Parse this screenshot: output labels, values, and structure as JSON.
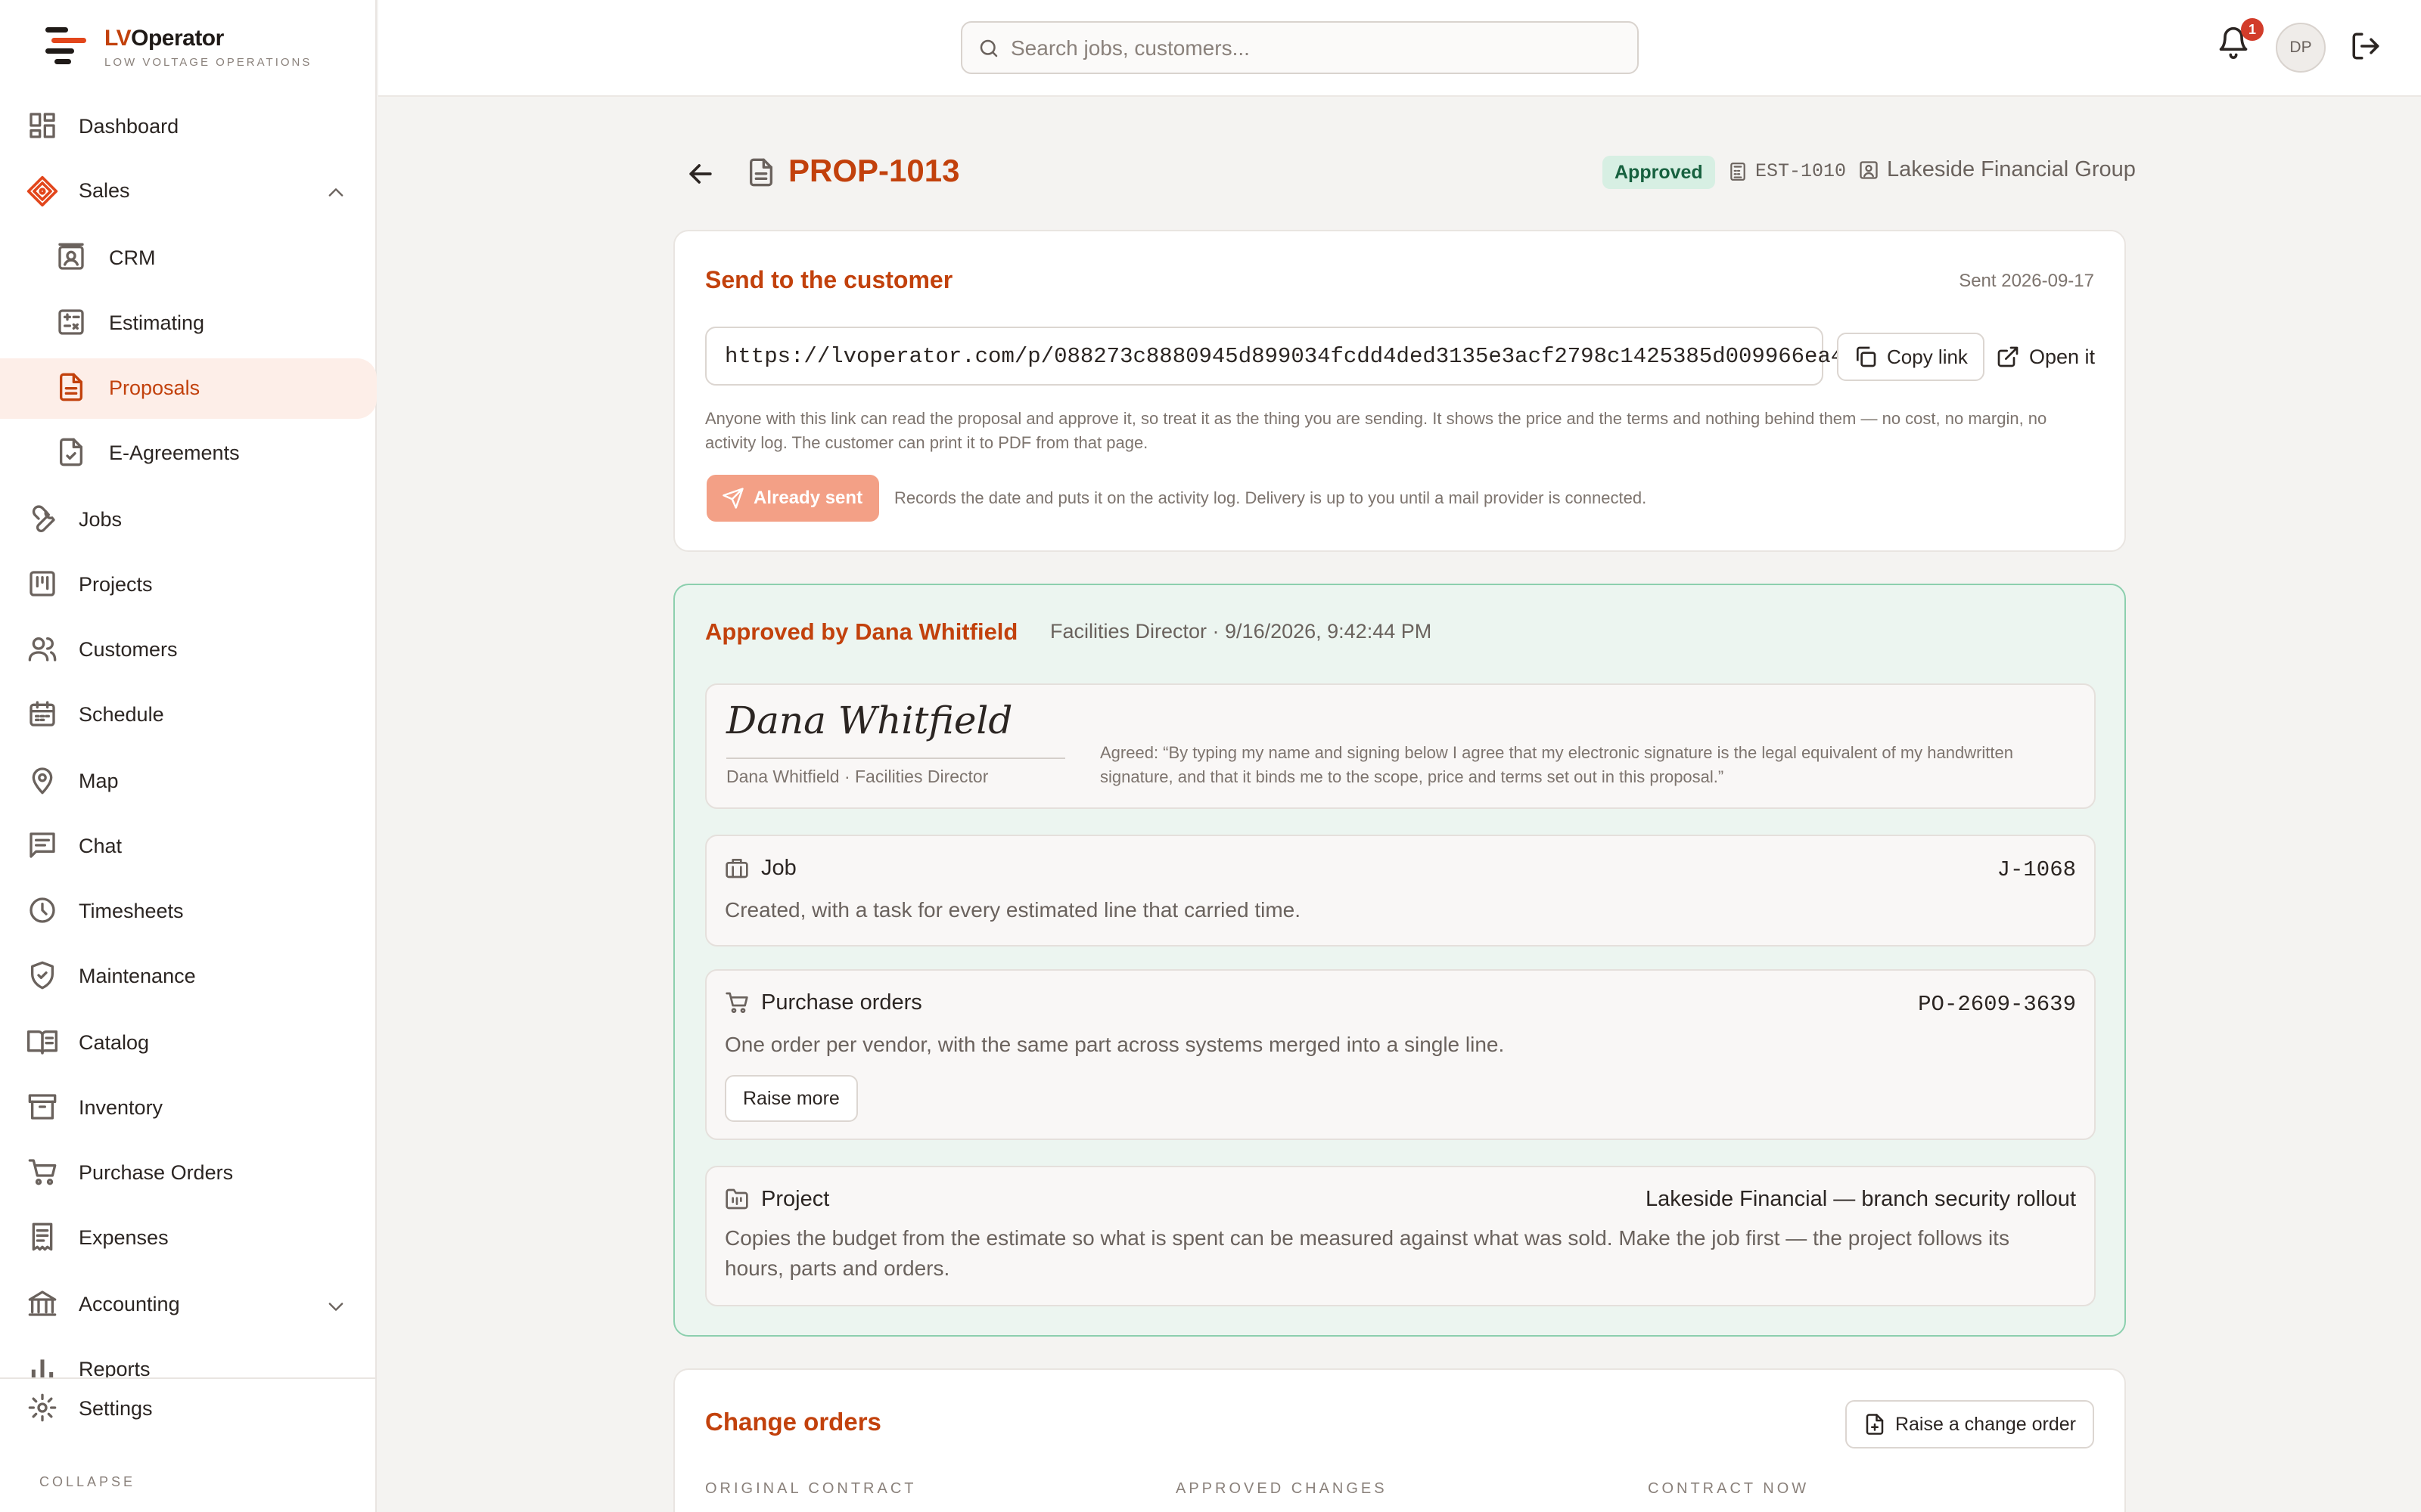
{
  "app": {
    "name_prefix": "LV",
    "name_rest": "Operator",
    "subtitle": "LOW VOLTAGE OPERATIONS"
  },
  "sidebar": {
    "items": [
      {
        "label": "Dashboard",
        "icon": "dashboard-icon"
      },
      {
        "label": "Sales",
        "icon": "tag-icon"
      },
      {
        "label": "CRM",
        "icon": "contact-card-icon"
      },
      {
        "label": "Estimating",
        "icon": "calculator-icon"
      },
      {
        "label": "Proposals",
        "icon": "document-icon"
      },
      {
        "label": "E-Agreements",
        "icon": "file-check-icon"
      },
      {
        "label": "Jobs",
        "icon": "wrench-icon"
      },
      {
        "label": "Projects",
        "icon": "kanban-icon"
      },
      {
        "label": "Customers",
        "icon": "users-icon"
      },
      {
        "label": "Schedule",
        "icon": "calendar-icon"
      },
      {
        "label": "Map",
        "icon": "map-pin-icon"
      },
      {
        "label": "Chat",
        "icon": "message-icon"
      },
      {
        "label": "Timesheets",
        "icon": "clock-icon"
      },
      {
        "label": "Maintenance",
        "icon": "shield-check-icon"
      },
      {
        "label": "Catalog",
        "icon": "book-icon"
      },
      {
        "label": "Inventory",
        "icon": "archive-icon"
      },
      {
        "label": "Purchase Orders",
        "icon": "cart-icon"
      },
      {
        "label": "Expenses",
        "icon": "receipt-icon"
      },
      {
        "label": "Accounting",
        "icon": "bank-icon"
      },
      {
        "label": "Reports",
        "icon": "bar-chart-icon"
      }
    ],
    "settings_label": "Settings",
    "collapse_label": "COLLAPSE"
  },
  "topbar": {
    "search_placeholder": "Search jobs, customers...",
    "notification_count": "1",
    "avatar_initials": "DP"
  },
  "proposal": {
    "id": "PROP-1013",
    "status": "Approved",
    "estimate_ref": "EST-1010",
    "customer": "Lakeside Financial Group"
  },
  "send": {
    "title": "Send to the customer",
    "sent_date": "Sent 2026-09-17",
    "link": "https://lvoperator.com/p/088273c8880945d899034fcdd4ded3135e3acf2798c1425385d009966ea4",
    "copy_label": "Copy link",
    "open_label": "Open it",
    "help": "Anyone with this link can read the proposal and approve it, so treat it as the thing you are sending. It shows the price and the terms and nothing behind them — no cost, no margin, no activity log. The customer can print it to PDF from that page.",
    "already_sent_label": "Already sent",
    "sent_note": "Records the date and puts it on the activity log. Delivery is up to you until a mail provider is connected."
  },
  "approval": {
    "title": "Approved by Dana Whitfield",
    "meta": "Facilities Director · 9/16/2026, 9:42:44 PM",
    "signature": "Dana Whitfield",
    "signer_line": "Dana Whitfield · Facilities Director",
    "agreement": "Agreed: “By typing my name and signing below I agree that my electronic signature is the legal equivalent of my handwritten signature, and that it binds me to the scope, price and terms set out in this proposal.”"
  },
  "job": {
    "title": "Job",
    "ref": "J-1068",
    "desc": "Created, with a task for every estimated line that carried time."
  },
  "purchase_orders": {
    "title": "Purchase orders",
    "ref": "PO-2609-3639",
    "desc": "One order per vendor, with the same part across systems merged into a single line.",
    "button": "Raise more"
  },
  "project": {
    "title": "Project",
    "ref": "Lakeside Financial — branch security rollout",
    "desc": "Copies the budget from the estimate so what is spent can be measured against what was sold. Make the job first — the project follows its hours, parts and orders."
  },
  "change_orders": {
    "title": "Change orders",
    "button": "Raise a change order",
    "columns": [
      "ORIGINAL CONTRACT",
      "APPROVED CHANGES",
      "CONTRACT NOW"
    ]
  },
  "colors": {
    "accent": "#c2410c",
    "approved_bg": "#d7efe3",
    "approved_text": "#17613f",
    "green_panel": "#ecf5f0"
  }
}
